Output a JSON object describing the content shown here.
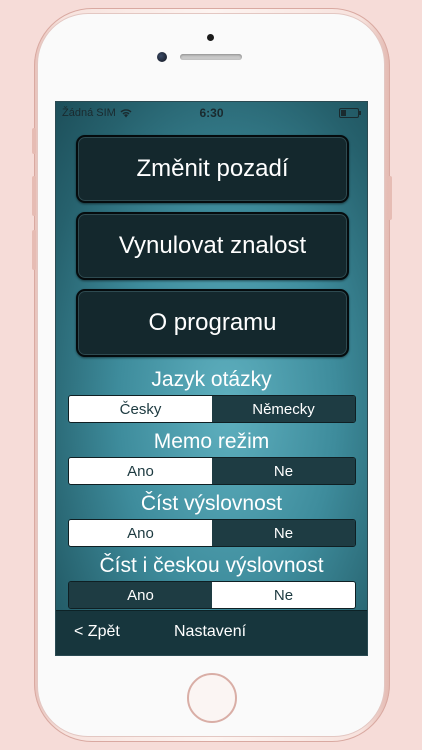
{
  "status_bar": {
    "carrier": "Žádná SIM",
    "time": "6:30"
  },
  "buttons": {
    "change_background": "Změnit pozadí",
    "reset_knowledge": "Vynulovat znalost",
    "about": "O programu"
  },
  "settings": [
    {
      "label": "Jazyk otázky",
      "options": [
        "Česky",
        "Německy"
      ],
      "selected": 0
    },
    {
      "label": "Memo režim",
      "options": [
        "Ano",
        "Ne"
      ],
      "selected": 0
    },
    {
      "label": "Číst výslovnost",
      "options": [
        "Ano",
        "Ne"
      ],
      "selected": 0
    },
    {
      "label": "Číst i českou výslovnost",
      "options": [
        "Ano",
        "Ne"
      ],
      "selected": 1
    }
  ],
  "nav": {
    "back": "< Zpět",
    "title": "Nastavení"
  },
  "colors": {
    "selected_segment": "#ffffff",
    "unselected_segment": "#1e3c43",
    "button_fill": "#14282d",
    "bottom_bar": "#17363d"
  }
}
